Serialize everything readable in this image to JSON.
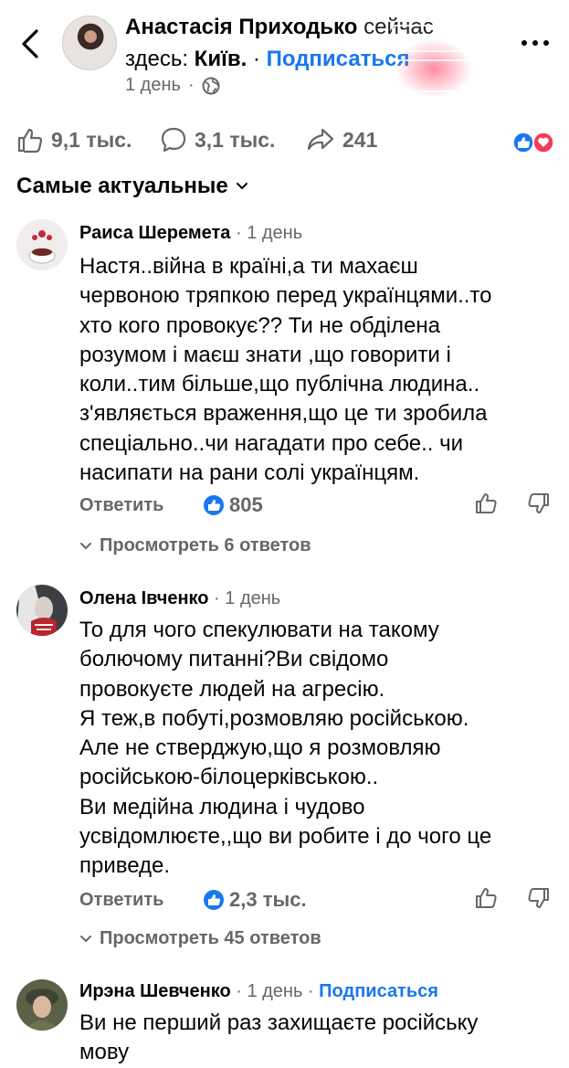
{
  "post": {
    "author": "Анастасія Приходько",
    "author_suffix": "сейчас",
    "location_prefix": "здесь:",
    "location": "Київ.",
    "separator": "·",
    "subscribe": "Подписаться",
    "time": "1 день"
  },
  "reactions": {
    "likes": "9,1 тыс.",
    "comments": "3,1 тыс.",
    "shares": "241"
  },
  "sort": {
    "label": "Самые актуальные"
  },
  "comments": [
    {
      "author": "Раиса Шеремета",
      "meta": "· 1 день",
      "text": "Настя..війна в країні,а ти махаєш\nчервоною тряпкою перед українцями..то\nхто кого провокує?? Ти не обділена\nрозумом і маєш знати ,що говорити і\nколи..тим більше,що публічна людина..\nз'являється враження,що це ти зробила\nспеціально..чи нагадати про себе.. чи\nнасипати на рани солі українцям.",
      "reply": "Ответить",
      "likes": "805",
      "view_replies": "Просмотреть 6 ответов"
    },
    {
      "author": "Олена Івченко",
      "meta": "· 1 день",
      "text": "То для чого спекулювати на такому\nболючому питанні?Ви свідомо\nпровокуєте людей на агресію.\nЯ теж,в побуті,розмовляю російською.\nАле не стверджую,що я розмовляю\nросійською-білоцерківською..\nВи медійна людина і чудово\nусвідомлюєте,,що ви робите і до чого це\nприведе.",
      "reply": "Ответить",
      "likes": "2,3 тыс.",
      "view_replies": "Просмотреть 45 ответов"
    },
    {
      "author": "Ирэна Шевченко",
      "meta": "· 1 день ·",
      "subscribe": "Подписаться",
      "text": "Ви не перший раз захищаєте російську\nмову"
    }
  ],
  "colors": {
    "accent": "#1877f2",
    "secondary_text": "#65676b",
    "love": "#f33e58"
  },
  "icons": [
    "chevron-left-icon",
    "globe-icon",
    "more-dots-icon",
    "like-icon",
    "comment-icon",
    "share-icon",
    "like-reaction-icon",
    "love-reaction-icon",
    "chevron-down-icon",
    "thumbs-up-icon",
    "thumbs-down-icon"
  ]
}
